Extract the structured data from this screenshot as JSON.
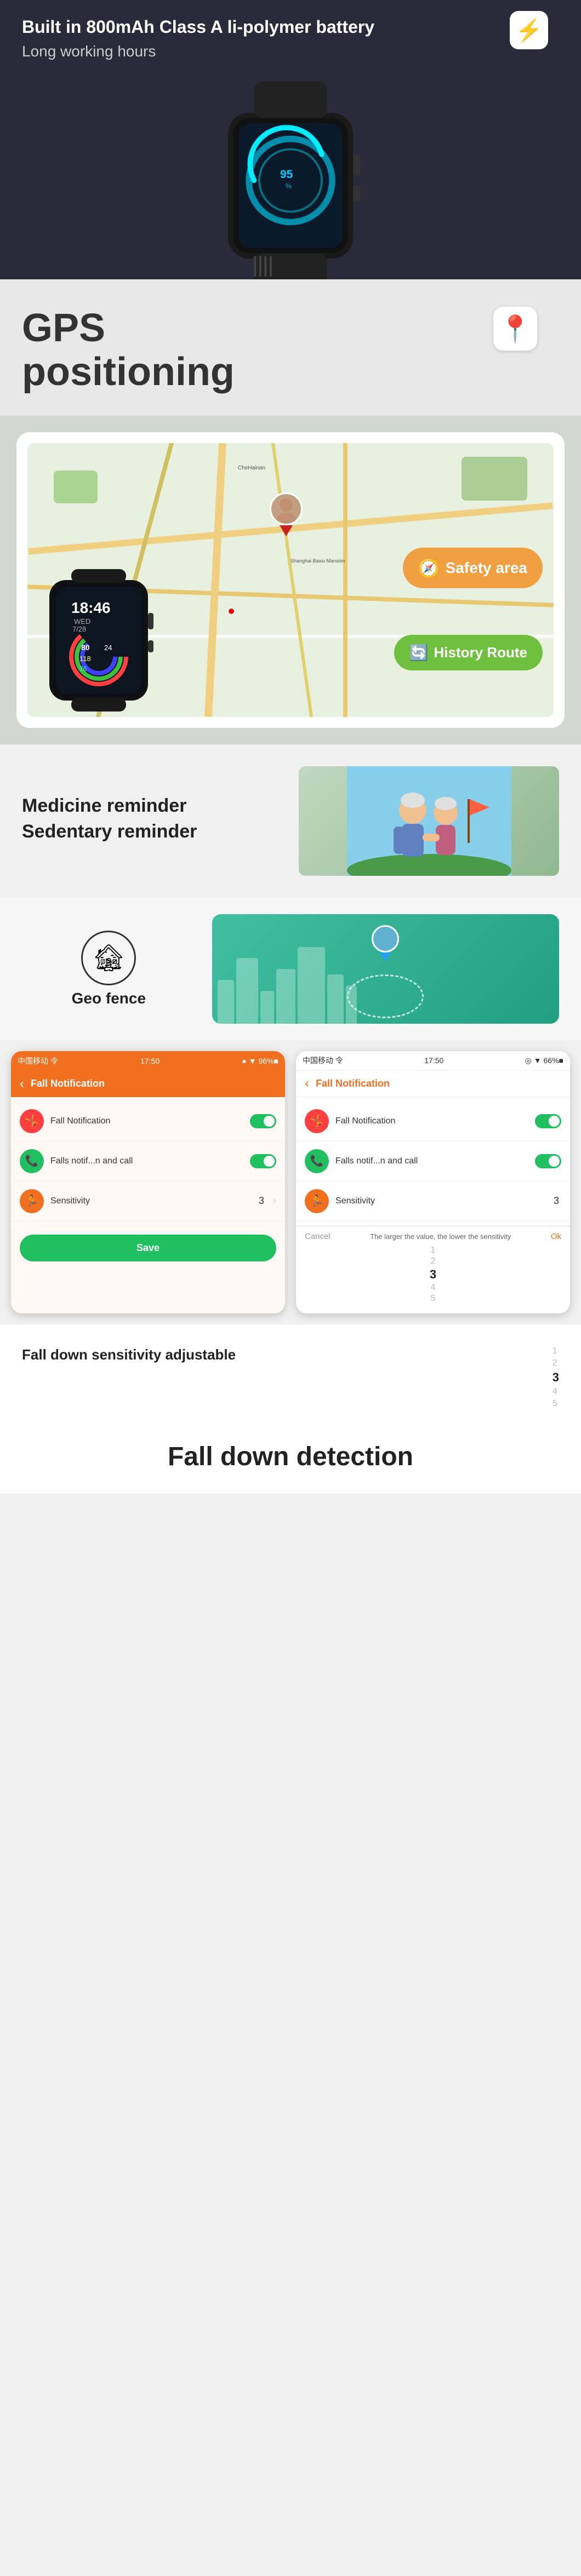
{
  "battery": {
    "title_line1": "Built in 800mAh Class A li-polymer battery",
    "subtitle": "Long working hours",
    "lightning_icon": "⚡"
  },
  "gps": {
    "title": "GPS",
    "subtitle": "positioning",
    "icon": "📍"
  },
  "map_buttons": {
    "safety_area": "Safety area",
    "history_route": "History Route"
  },
  "medicine": {
    "line1": "Medicine reminder",
    "line2": "Sedentary reminder"
  },
  "geofence": {
    "label": "Geo fence"
  },
  "fall_screen_left": {
    "statusbar_carrier": "中国移动 令",
    "statusbar_time": "17:50",
    "statusbar_signal": "● ▼ 96%■",
    "back_icon": "‹",
    "header_title": "Fall Notification",
    "row1_label": "Fall Notification",
    "row2_label": "Falls notif...n and call",
    "row3_label": "Sensitivity",
    "row3_value": "3",
    "save_label": "Save"
  },
  "fall_screen_right": {
    "statusbar_carrier": "中国移动 令",
    "statusbar_time": "17:50",
    "statusbar_signal": "◎ ▼ 66%■",
    "back_icon": "‹",
    "header_title": "Fall Notification",
    "row1_label": "Fall Notification",
    "row2_label": "Falls notif...n and call",
    "row3_label": "Sensitivity",
    "row3_value": "3",
    "picker_cancel": "Cancel",
    "picker_hint": "The larger the value, the lower the sensitivity",
    "picker_ok": "Ok",
    "nums": [
      "1",
      "2",
      "3",
      "4",
      "5"
    ],
    "active_num_index": 2
  },
  "fall_bottom": {
    "desc": "Fall down sensitivity adjustable",
    "nums": [
      "1",
      "2",
      "3",
      "4",
      "5"
    ]
  },
  "fall_detection": {
    "title": "Fall down detection"
  }
}
